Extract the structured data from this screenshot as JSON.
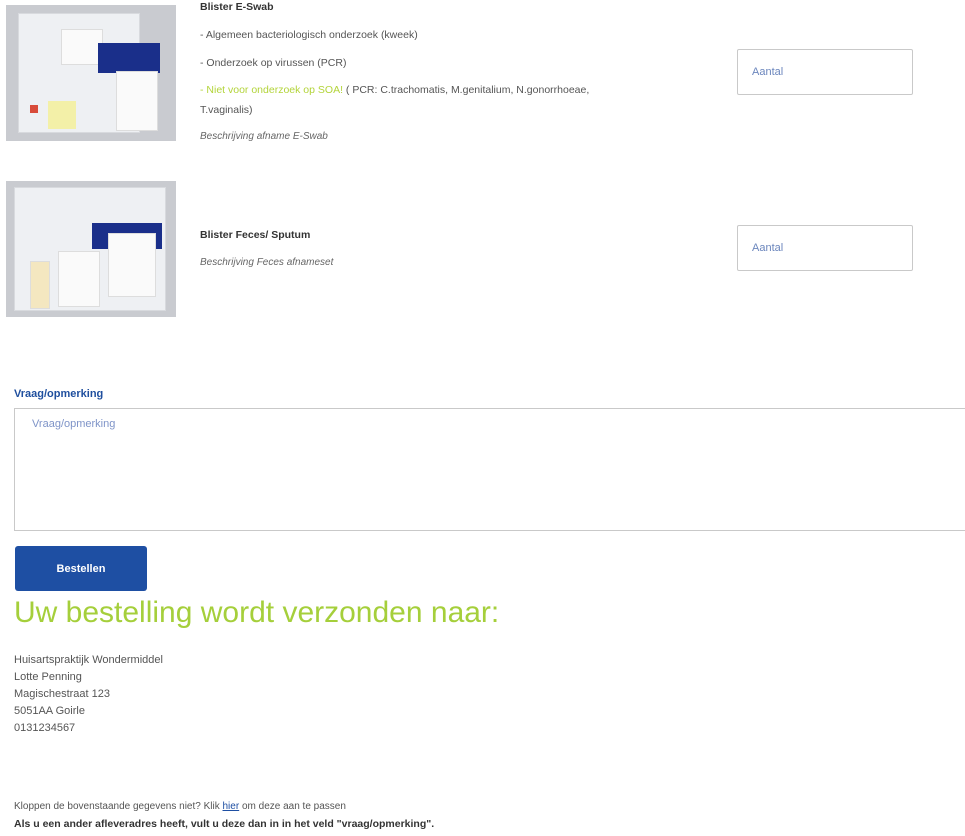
{
  "products": [
    {
      "title": "Blister E-Swab",
      "lines": [
        "- Algemeen bacteriologisch onderzoek (kweek)",
        "- Onderzoek op virussen (PCR)"
      ],
      "warning_prefix": "- Niet voor onderzoek op SOA!",
      "warning_rest": " ( PCR: C.trachomatis, M.genitalium, N.gonorrhoeae,",
      "warning_cont": "T.vaginalis)",
      "description": "Beschrijving afname E-Swab",
      "qty_placeholder": "Aantal"
    },
    {
      "title": "Blister Feces/ Sputum",
      "description": "Beschrijving Feces afnameset",
      "qty_placeholder": "Aantal"
    }
  ],
  "remark": {
    "label": "Vraag/opmerking",
    "placeholder": "Vraag/opmerking"
  },
  "order_button": "Bestellen",
  "shipping": {
    "title": "Uw bestelling wordt verzonden naar:",
    "address": [
      "Huisartspraktijk Wondermiddel",
      "Lotte Penning",
      "Magischestraat 123",
      "5051AA Goirle",
      "0131234567"
    ]
  },
  "notes": {
    "check_prefix": "Kloppen de bovenstaande gegevens niet? Klik ",
    "check_link": "hier",
    "check_suffix": " om deze aan te passen",
    "alt_address": "Als u een ander afleveradres heeft, vult u deze dan in in het veld \"vraag/opmerking\"."
  },
  "colors": {
    "accent_blue": "#1e4fa3",
    "accent_green": "#a5cf3b",
    "warning_yellow": "#b3d43a"
  }
}
